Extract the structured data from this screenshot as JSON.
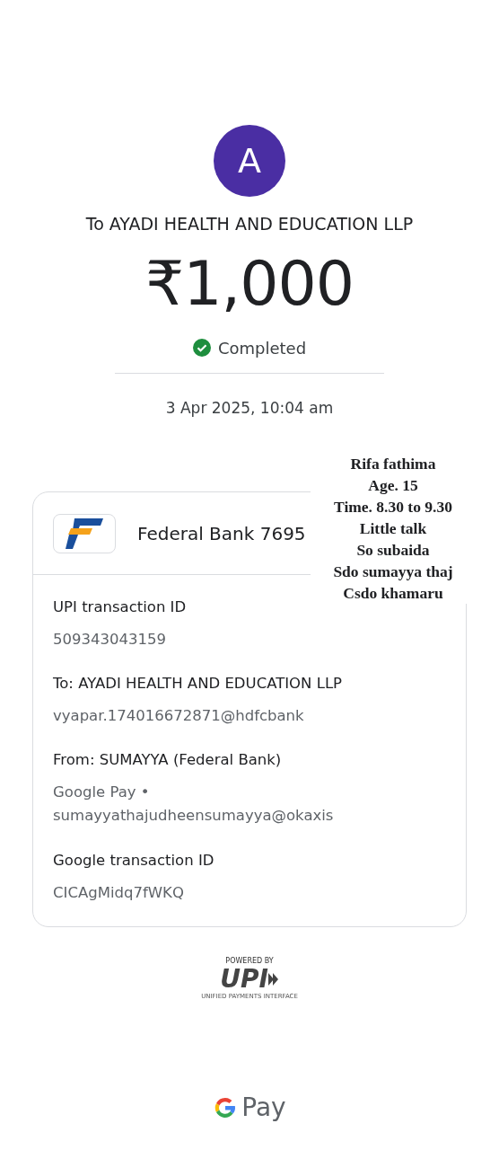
{
  "avatar": {
    "initial": "A"
  },
  "payee": "To AYADI HEALTH AND EDUCATION LLP",
  "amount": "₹1,000",
  "status": {
    "label": "Completed",
    "completed": true
  },
  "datetime": "3 Apr 2025, 10:04 am",
  "account": {
    "bank": "Federal Bank 7695"
  },
  "details": [
    {
      "label": "UPI transaction ID",
      "value": "509343043159"
    },
    {
      "label": "To: AYADI HEALTH AND EDUCATION LLP",
      "value": "vyapar.174016672871@hdfcbank"
    },
    {
      "label": "From: SUMAYYA  (Federal Bank)",
      "value": "Google Pay •\nsumayyathajudheensumayya@okaxis"
    },
    {
      "label": "Google transaction ID",
      "value": "CICAgMidq7fWKQ"
    }
  ],
  "note_lines": [
    "Rifa fathima",
    "Age. 15",
    "Time. 8.30 to 9.30",
    "Little talk",
    "So subaida",
    "Sdo sumayya thaj",
    "Csdo khamaru"
  ],
  "upi_badge": {
    "caption": "POWERED BY",
    "logo": "UPI",
    "tagline": "UNIFIED PAYMENTS INTERFACE"
  },
  "footer": {
    "brand": "Pay"
  }
}
